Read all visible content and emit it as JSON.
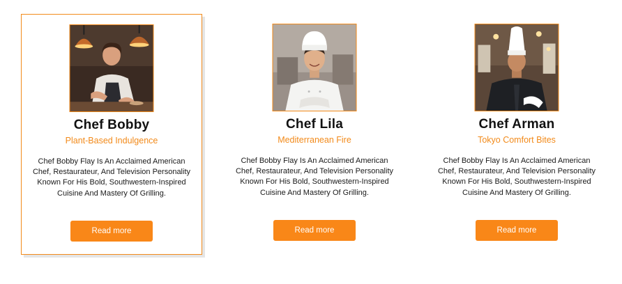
{
  "colors": {
    "accent": "#f28a1a",
    "button": "#f98718",
    "text": "#111111"
  },
  "chefs": [
    {
      "name": "Chef Bobby",
      "specialty": "Plant-Based Indulgence",
      "bio": "Chef Bobby Flay Is An Acclaimed American Chef, Restaurateur, And Television Personality Known For His Bold, Southwestern-Inspired Cuisine And Mastery Of Grilling.",
      "button_label": "Read more",
      "photo": "chef-cooking-photo"
    },
    {
      "name": "Chef Lila",
      "specialty": "Mediterranean Fire",
      "bio": "Chef Bobby Flay Is An Acclaimed American Chef, Restaurateur, And Television Personality Known For His Bold, Southwestern-Inspired Cuisine And Mastery Of Grilling.",
      "button_label": "Read more",
      "photo": "chef-portrait-photo"
    },
    {
      "name": "Chef Arman",
      "specialty": "Tokyo Comfort Bites",
      "bio": "Chef Bobby Flay Is An Acclaimed American Chef, Restaurateur, And Television Personality Known For His Bold, Southwestern-Inspired Cuisine And Mastery Of Grilling.",
      "button_label": "Read more",
      "photo": "chef-toque-photo"
    }
  ]
}
